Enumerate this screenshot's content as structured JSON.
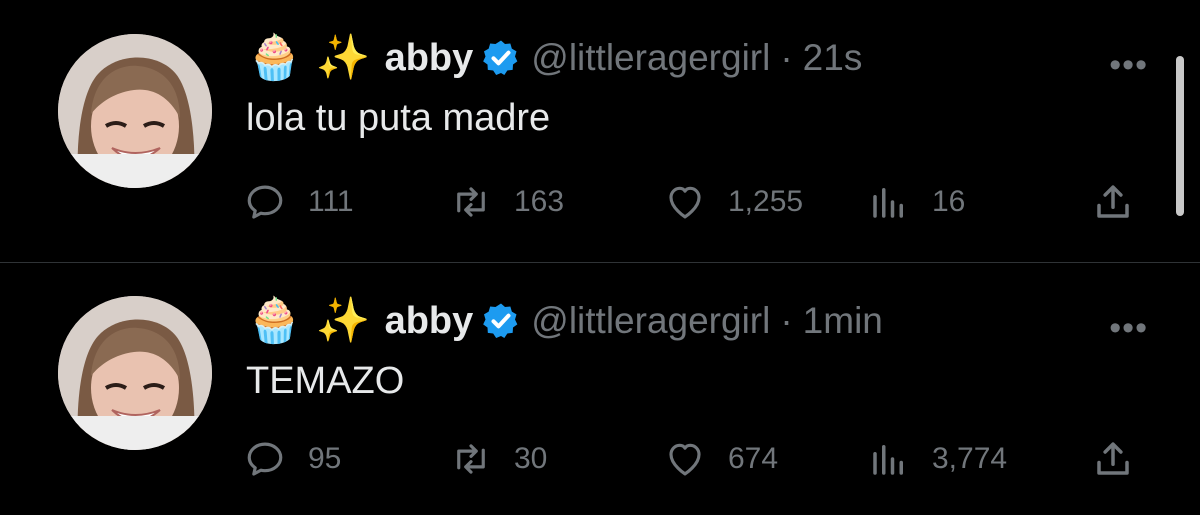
{
  "tweets": [
    {
      "emojis": "🧁 ✨",
      "display_name": "abby",
      "handle": "@littleragergirl",
      "separator": "·",
      "time": "21s",
      "text": "lola tu puta madre",
      "replies": "111",
      "retweets": "163",
      "likes": "1,255",
      "views": "16"
    },
    {
      "emojis": "🧁 ✨",
      "display_name": "abby",
      "handle": "@littleragergirl",
      "separator": "·",
      "time": "1min",
      "text": "TEMAZO",
      "replies": "95",
      "retweets": "30",
      "likes": "674",
      "views": "3,774"
    }
  ],
  "icons": {
    "reply": "reply-icon",
    "retweet": "retweet-icon",
    "like": "heart-icon",
    "views": "views-icon",
    "share": "share-icon",
    "more": "more-icon",
    "verified": "verified-badge-icon"
  },
  "colors": {
    "background": "#000000",
    "text": "#e7e9ea",
    "muted": "#71767b",
    "verified": "#1d9bf0",
    "divider": "#2f3336"
  }
}
